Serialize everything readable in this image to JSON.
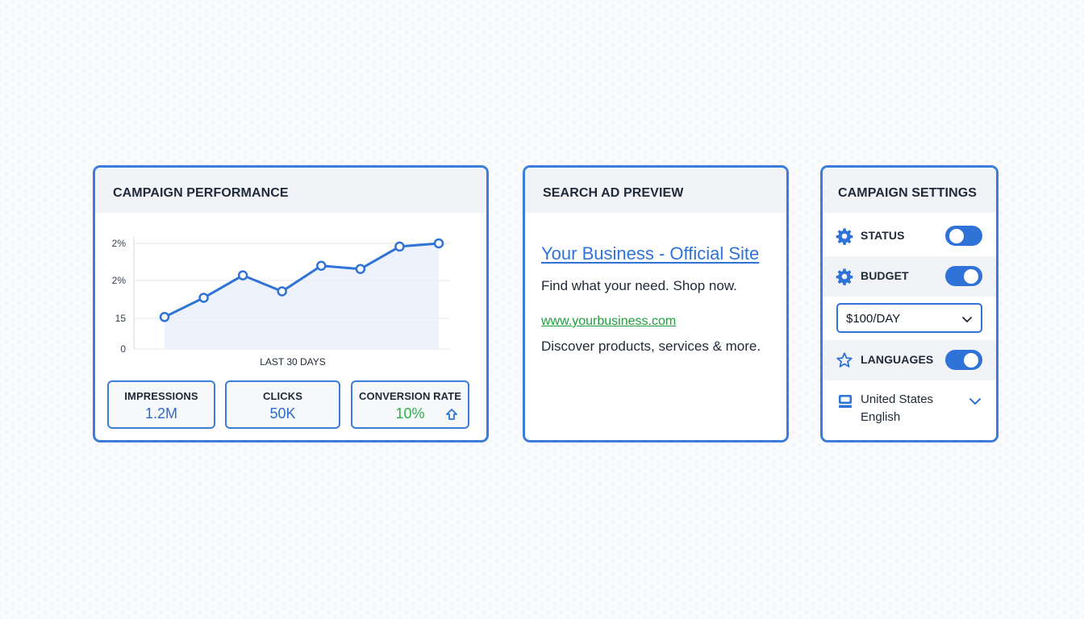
{
  "performance": {
    "title": "CAMPAIGN PERFORMANCE",
    "stats": [
      {
        "label": "IMPRESSIONS",
        "value": "1.2M"
      },
      {
        "label": "CLICKS",
        "value": "50K"
      },
      {
        "label": "CONVERSION RATE",
        "value": "10%"
      }
    ]
  },
  "chart_data": {
    "type": "line",
    "xlabel": "LAST 30 DAYS",
    "ylabel": "",
    "y_tick_labels": [
      "0",
      "15",
      "2%",
      "2%"
    ],
    "series": [
      {
        "values": [
          10,
          16,
          23,
          18,
          26,
          25,
          32,
          33
        ]
      }
    ],
    "ylim": [
      0,
      35
    ],
    "grid": true,
    "area_fill": true,
    "color": "#2f73d8"
  },
  "ad_preview": {
    "title": "SEARCH AD PREVIEW",
    "headline": "Your Business - Official Site",
    "description": "Find what your need. Shop now.",
    "url": "www.yourbusiness.com",
    "description2": "Discover products, services & more."
  },
  "settings": {
    "title": "CAMPAIGN SETTINGS",
    "status": {
      "label": "STATUS",
      "icon": "gear-icon",
      "enabled": false
    },
    "budget": {
      "label": "BUDGET",
      "icon": "gear-icon",
      "enabled": true,
      "value": "$100/DAY"
    },
    "languages": {
      "label": "LANGUAGES",
      "icon": "star-icon",
      "enabled": true
    },
    "locale": {
      "icon": "computer-icon",
      "country": "United States",
      "language": "English"
    }
  },
  "colors": {
    "accent": "#2f73d8",
    "border": "#3b7ddb",
    "success": "#2bb24c"
  }
}
